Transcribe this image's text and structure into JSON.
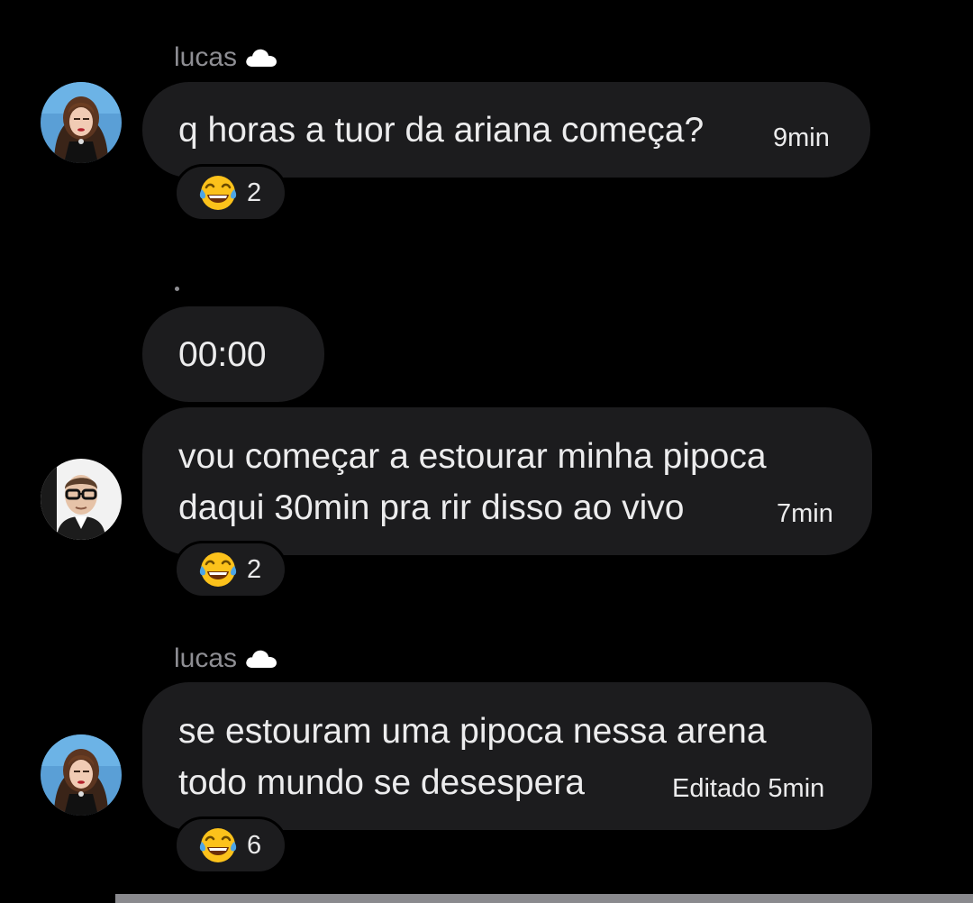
{
  "messages": [
    {
      "sender": "lucas",
      "sender_icon": "cloud-icon",
      "text_lines": [
        "q horas a tuor da ariana começa?"
      ],
      "time": "9min",
      "reaction": {
        "emoji": "tears-of-joy-emoji",
        "count": "2"
      }
    },
    {
      "sender": ".",
      "text_lines": [
        "00:00"
      ]
    },
    {
      "text_lines": [
        "vou começar a estourar minha pipoca",
        "daqui 30min pra rir disso ao vivo"
      ],
      "time": "7min",
      "reaction": {
        "emoji": "tears-of-joy-emoji",
        "count": "2"
      }
    },
    {
      "sender": "lucas",
      "sender_icon": "cloud-icon",
      "text_lines": [
        "se estouram uma pipoca nessa arena",
        "todo mundo se desespera"
      ],
      "time": "Editado 5min",
      "reaction": {
        "emoji": "tears-of-joy-emoji",
        "count": "6"
      }
    }
  ],
  "colors": {
    "background": "#000000",
    "bubble": "#1c1c1e",
    "sender_name": "#8e8e93",
    "text": "#ececed"
  }
}
